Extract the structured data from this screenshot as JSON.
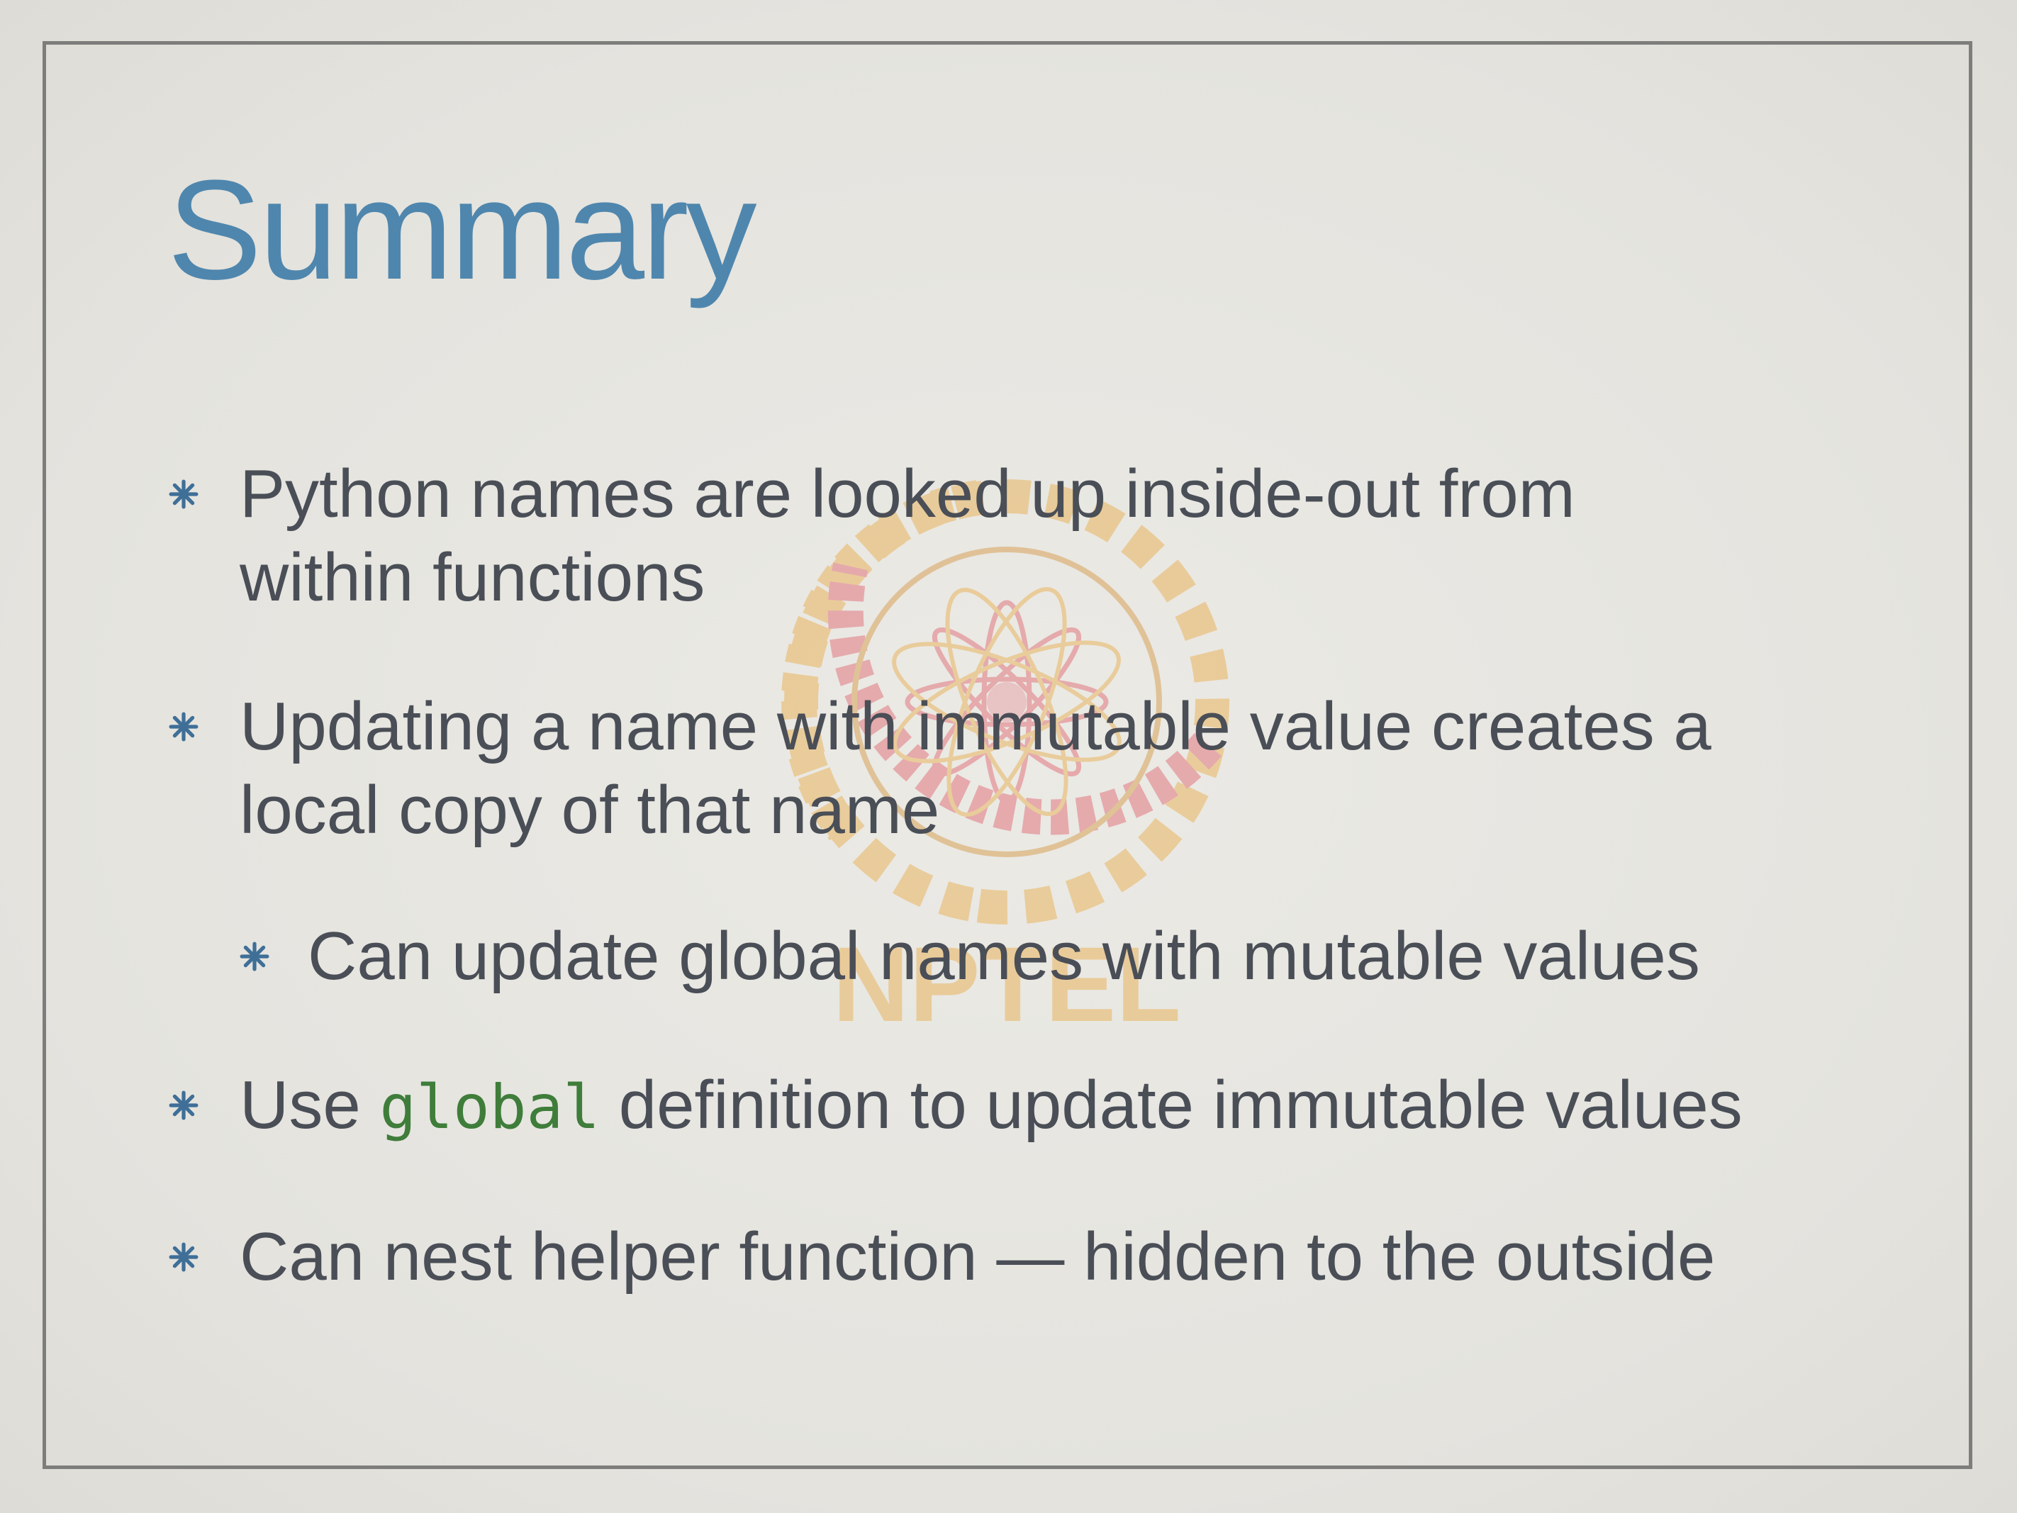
{
  "slide": {
    "title": "Summary",
    "bullets": [
      {
        "text": "Python names are looked up inside-out from\nwithin functions"
      },
      {
        "text": "Updating a name with immutable value creates a\nlocal copy of that name"
      },
      {
        "text": "Can update global names with mutable values"
      },
      {
        "before": "Use ",
        "code": "global",
        "after": " definition to update immutable values"
      },
      {
        "text": "Can nest helper function — hidden to the outside"
      }
    ],
    "watermark": {
      "logo_text": "NPTEL",
      "icon": "nptel-logo-icon",
      "colors": [
        "#e9b560",
        "#e27780"
      ]
    },
    "colors": {
      "title": "#4f86ad",
      "body": "#4a4e56",
      "code": "#3f7d3a",
      "bullet": "#3f6f97",
      "frame": "#7d7d7b"
    }
  }
}
